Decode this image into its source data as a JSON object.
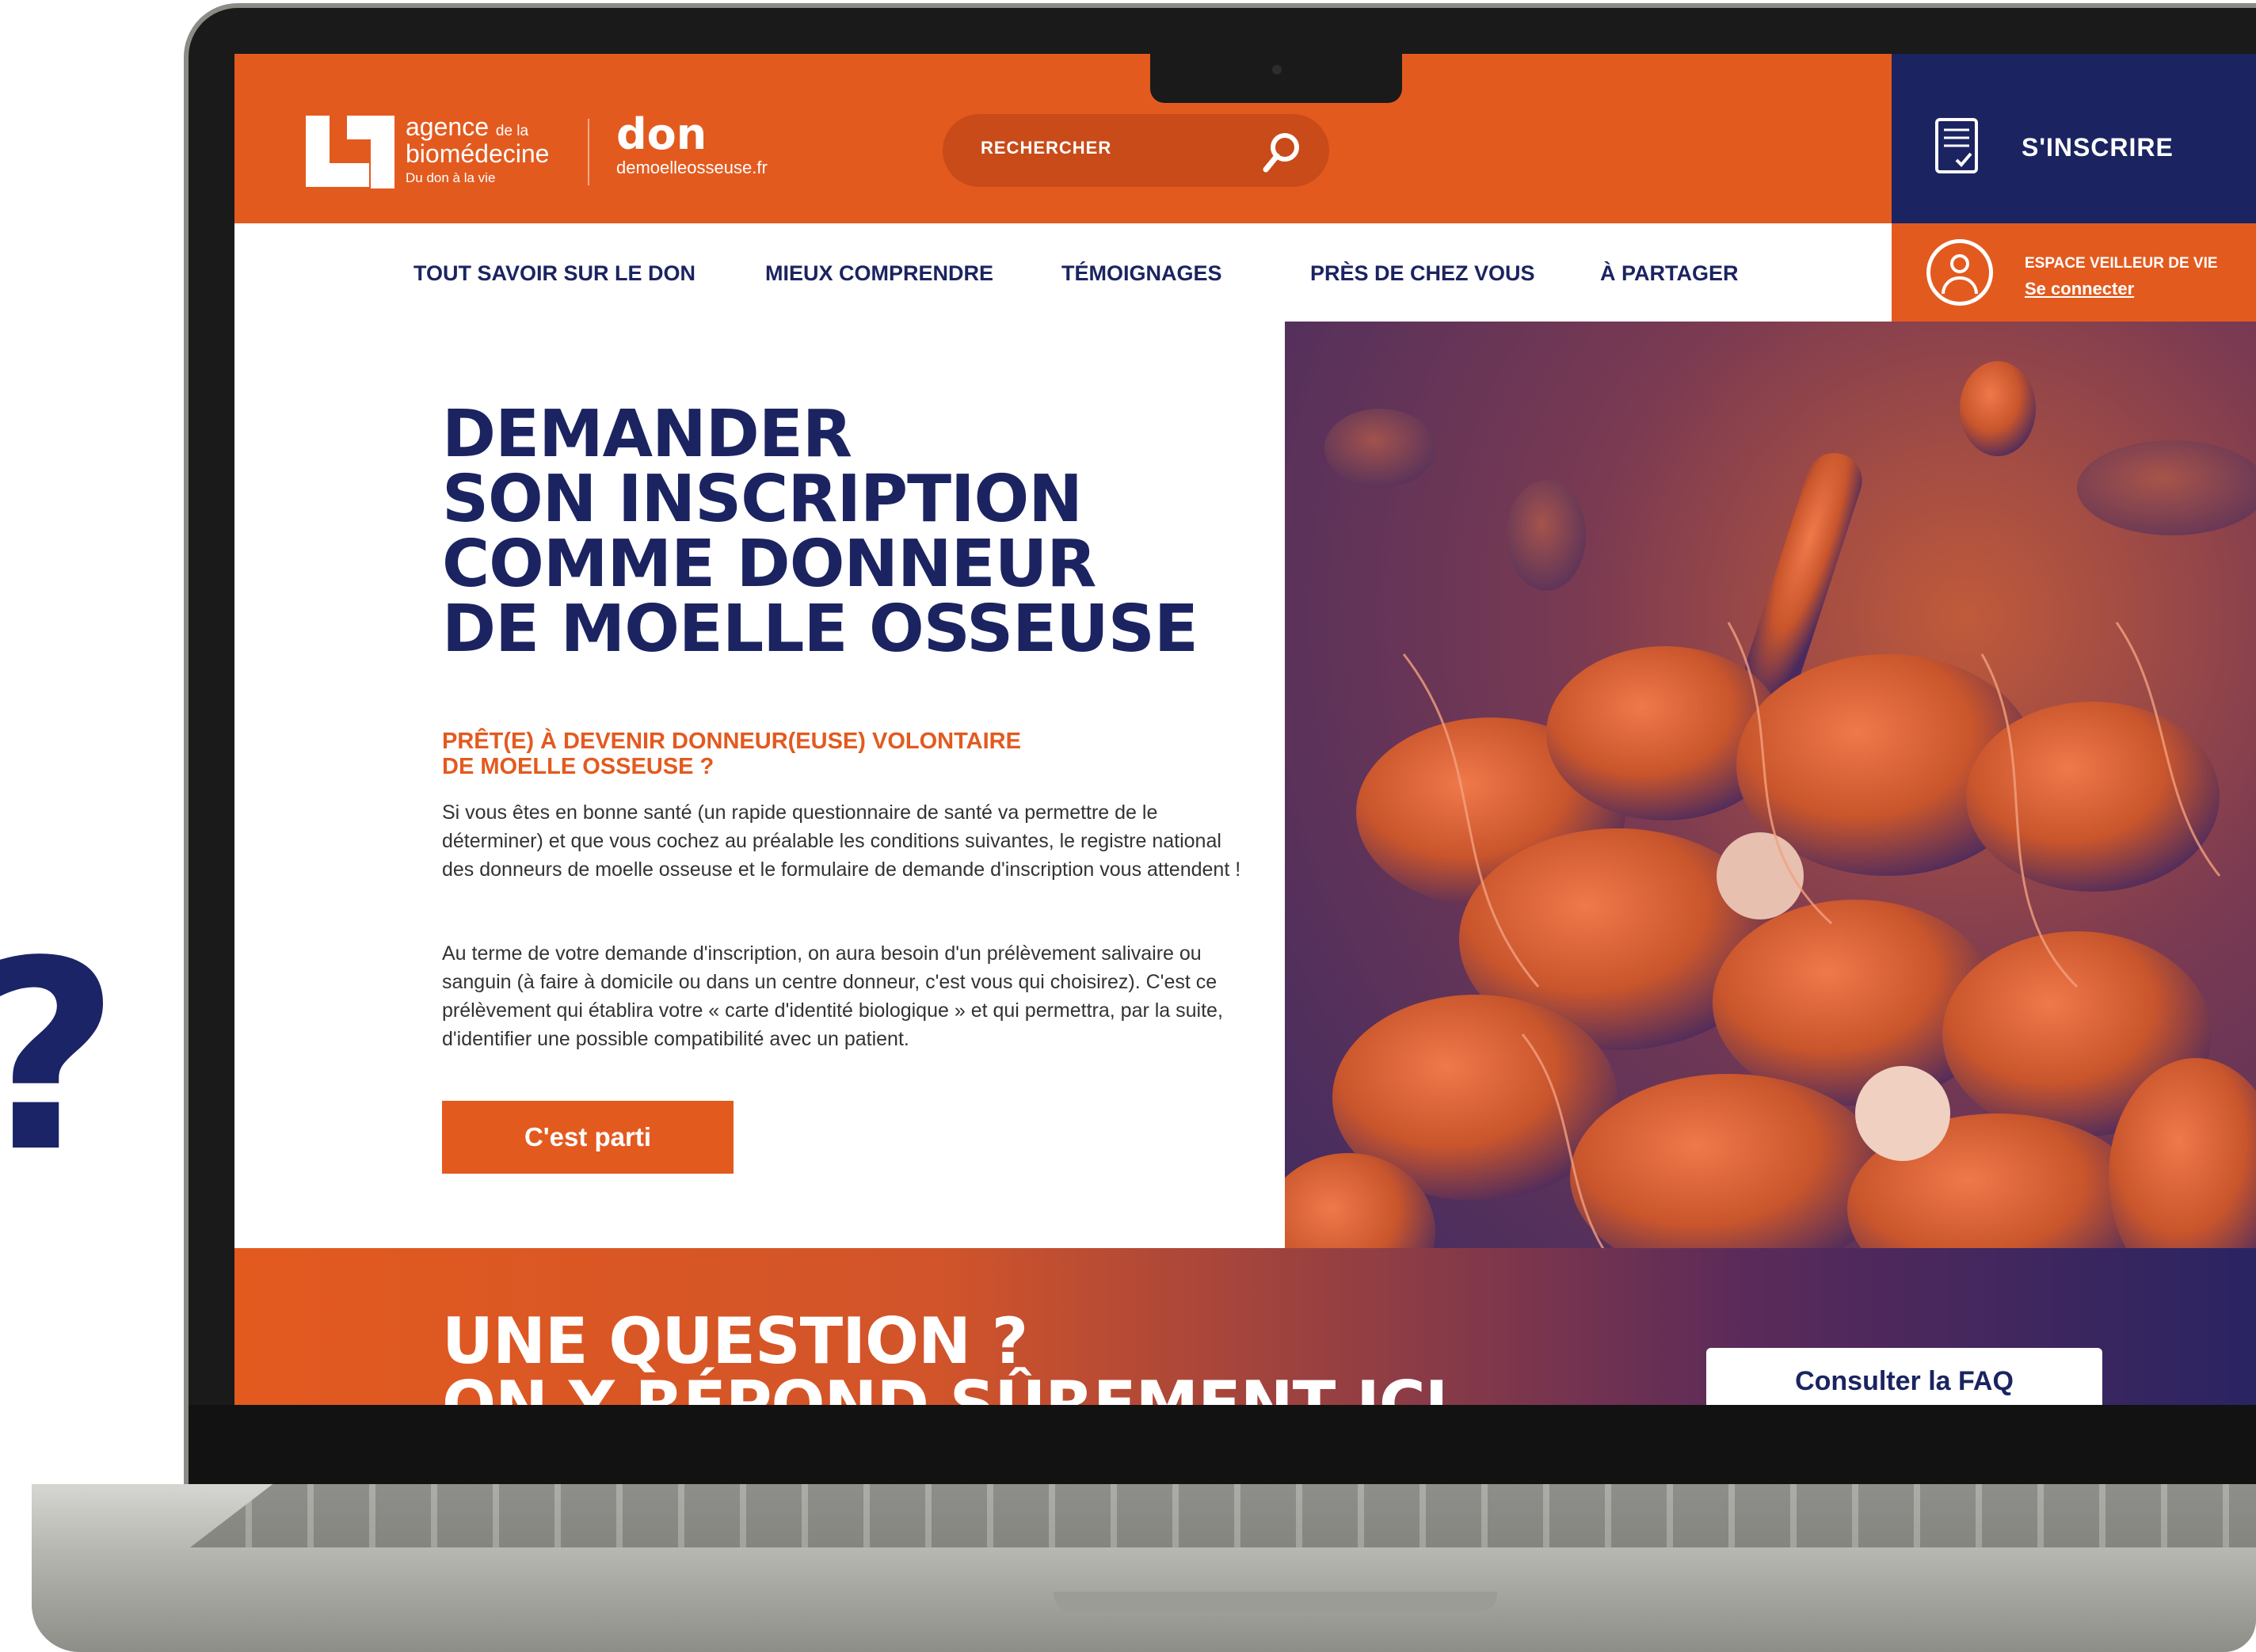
{
  "side_mark": "?",
  "header": {
    "agency_line1": "agence",
    "agency_line1_small": "de la",
    "agency_line2": "biomédecine",
    "agency_tagline": "Du don à la vie",
    "site_name": "don",
    "site_domain": "demoelleosseuse.fr",
    "search_placeholder": "RECHERCHER",
    "signup_label": "S'INSCRIRE",
    "account_title": "ESPACE VEILLEUR DE VIE",
    "account_link": "Se connecter"
  },
  "nav": {
    "items": [
      {
        "label": "TOUT SAVOIR SUR LE DON"
      },
      {
        "label": "MIEUX COMPRENDRE"
      },
      {
        "label": "TÉMOIGNAGES"
      },
      {
        "label": "PRÈS DE CHEZ VOUS"
      },
      {
        "label": "À PARTAGER"
      }
    ]
  },
  "hero": {
    "title_lines": [
      "DEMANDER",
      "SON INSCRIPTION",
      "COMME DONNEUR",
      "DE MOELLE OSSEUSE"
    ],
    "subtitle_line1": "PRÊT(E) À DEVENIR DONNEUR(EUSE) VOLONTAIRE",
    "subtitle_line2": "DE MOELLE OSSEUSE ?",
    "paragraph1": "Si vous êtes en bonne santé (un rapide questionnaire de santé va permettre de le déterminer) et que vous cochez au préalable les conditions suivantes, le registre national des donneurs de moelle osseuse et le formulaire de demande d'inscription vous attendent !",
    "paragraph2": "Au terme de votre demande d'inscription, on aura besoin d'un prélèvement salivaire ou sanguin (à faire à domicile ou dans un centre donneur, c'est vous qui choisirez). C'est ce prélèvement qui établira votre « carte d'identité biologique » et qui permettra, par la suite, d'identifier une possible compatibilité avec un patient.",
    "cta_label": "C'est parti"
  },
  "faq": {
    "title_line1": "UNE QUESTION ?",
    "title_line2": "ON Y RÉPOND SÛREMENT ICI",
    "button_label": "Consulter la FAQ"
  },
  "colors": {
    "brand_orange": "#e35a1f",
    "brand_navy": "#1b2461",
    "search_bg": "#c84b19"
  },
  "icons": {
    "search": "search-icon",
    "signup": "document-check-icon",
    "account": "user-circle-icon"
  }
}
